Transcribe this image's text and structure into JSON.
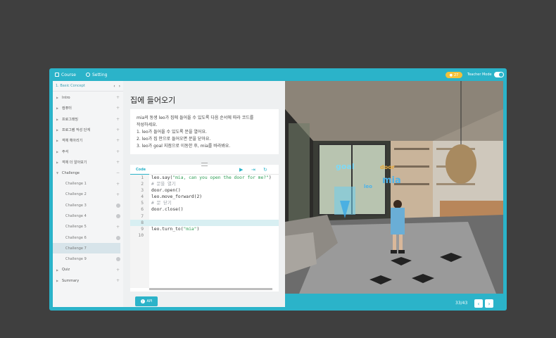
{
  "topbar": {
    "course_label": "Course",
    "setting_label": "Setting",
    "coins": "27",
    "teacher_mode_label": "Teacher Mode"
  },
  "sidebar": {
    "header": "1. Basic Concept",
    "items": [
      {
        "label": "Intro",
        "level": "top",
        "mark": "plus"
      },
      {
        "label": "컴퓨터",
        "level": "top",
        "mark": "plus"
      },
      {
        "label": "프로그래밍",
        "level": "top",
        "mark": "plus"
      },
      {
        "label": "프로그램 작성 단계",
        "level": "top",
        "mark": "plus"
      },
      {
        "label": "객체 헤아리기",
        "level": "top",
        "mark": "plus"
      },
      {
        "label": "주석",
        "level": "top",
        "mark": "plus"
      },
      {
        "label": "객체 더 알아보기",
        "level": "top",
        "mark": "plus"
      },
      {
        "label": "Challenge",
        "level": "top",
        "mark": "minus"
      },
      {
        "label": "Challenge 1",
        "level": "sub",
        "mark": "plus"
      },
      {
        "label": "Challenge 2",
        "level": "sub",
        "mark": "plus"
      },
      {
        "label": "Challenge 3",
        "level": "sub",
        "mark": "dot"
      },
      {
        "label": "Challenge 4",
        "level": "sub",
        "mark": "dot"
      },
      {
        "label": "Challenge 5",
        "level": "sub",
        "mark": "plus"
      },
      {
        "label": "Challenge 6",
        "level": "sub",
        "mark": "dot"
      },
      {
        "label": "Challenge 7",
        "level": "sub",
        "mark": "none",
        "active": true
      },
      {
        "label": "Challenge 9",
        "level": "sub",
        "mark": "dot"
      },
      {
        "label": "Quiz",
        "level": "top",
        "mark": "plus"
      },
      {
        "label": "Summary",
        "level": "top",
        "mark": "plus"
      }
    ]
  },
  "content": {
    "title": "집에 들어오기",
    "mission_lines": [
      "mia의 동생 leo가 집에 들어올 수 있도록 다음 순서에 따라 코드를",
      "작성하세요.",
      "1. leo가 들어올 수 있도록 문을 열어요.",
      "2. leo가 집 안으로 들어오면 문을 닫아요.",
      "3. leo가 goal 지점으로 이동한 후, mia를 바라봐요."
    ]
  },
  "editor": {
    "tab_label": "Code",
    "lines": [
      {
        "n": "1",
        "parts": [
          {
            "t": "leo.say(",
            "c": ""
          },
          {
            "t": "\"mia, can you open the door for me?\"",
            "c": "str"
          },
          {
            "t": ")",
            "c": ""
          }
        ]
      },
      {
        "n": "2",
        "parts": [
          {
            "t": "# 문을 열기",
            "c": "cm"
          }
        ]
      },
      {
        "n": "3",
        "parts": [
          {
            "t": "door.open()",
            "c": ""
          }
        ]
      },
      {
        "n": "4",
        "parts": [
          {
            "t": "leo.move_forward(2)",
            "c": ""
          }
        ]
      },
      {
        "n": "5",
        "parts": [
          {
            "t": "# 문 닫기",
            "c": "cm"
          }
        ]
      },
      {
        "n": "6",
        "parts": [
          {
            "t": "door.close()",
            "c": ""
          }
        ]
      },
      {
        "n": "7",
        "parts": [
          {
            "t": "",
            "c": ""
          }
        ]
      },
      {
        "n": "8",
        "parts": [
          {
            "t": "",
            "c": ""
          }
        ],
        "highlight": true
      },
      {
        "n": "9",
        "parts": [
          {
            "t": "leo.turn_to(",
            "c": ""
          },
          {
            "t": "\"mia\"",
            "c": "str"
          },
          {
            "t": ")",
            "c": ""
          }
        ]
      },
      {
        "n": "10",
        "parts": [
          {
            "t": "",
            "c": ""
          }
        ]
      }
    ]
  },
  "scene": {
    "labels": [
      "goal",
      "door",
      "mia",
      "leo"
    ]
  },
  "footer": {
    "api_label": "API",
    "page_indicator": "33/43"
  }
}
